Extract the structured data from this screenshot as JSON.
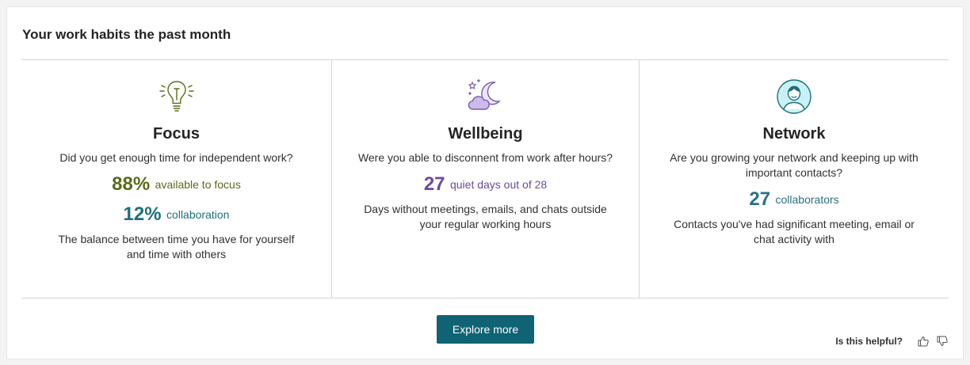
{
  "title": "Your work habits the past month",
  "columns": {
    "focus": {
      "heading": "Focus",
      "question": "Did you get enough time for independent work?",
      "metric1_value": "88%",
      "metric1_label": "available to focus",
      "metric2_value": "12%",
      "metric2_label": "collaboration",
      "description": "The balance between time you have for yourself and time with others"
    },
    "wellbeing": {
      "heading": "Wellbeing",
      "question": "Were you able to disconnent from work after hours?",
      "metric_value": "27",
      "metric_label": "quiet days out of 28",
      "description": "Days without meetings, emails, and chats outside your regular working hours"
    },
    "network": {
      "heading": "Network",
      "question": "Are you growing your network and keeping up with important contacts?",
      "metric_value": "27",
      "metric_label": "collaborators",
      "description": "Contacts you've had significant meeting, email or chat activity with"
    }
  },
  "explore_button": "Explore more",
  "feedback": {
    "label": "Is this helpful?",
    "thumbs_up_icon": "thumbs-up-icon",
    "thumbs_down_icon": "thumbs-down-icon"
  },
  "icons": {
    "focus": "lightbulb-icon",
    "wellbeing": "moon-cloud-icon",
    "network": "person-avatar-icon"
  },
  "colors": {
    "focus_green": "#5a6b1c",
    "collab_teal": "#1e6f7a",
    "wellbeing_purple": "#6b4a9c",
    "network_blue": "#2a6f86",
    "button_bg": "#0f6374"
  }
}
